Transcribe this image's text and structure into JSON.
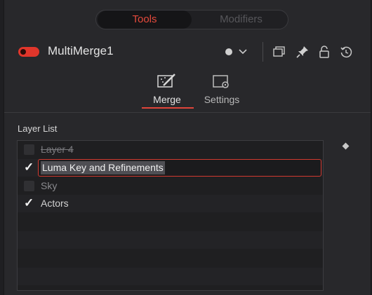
{
  "top_tabs": {
    "tools": "Tools",
    "modifiers": "Modifiers"
  },
  "header": {
    "node_name": "MultiMerge1"
  },
  "icons": {
    "node_toggle": "enable-toggle-icon",
    "version": "dot-icon",
    "dropdown": "chevron-down-icon",
    "window": "window-icon",
    "pin": "pin-icon",
    "lock": "lock-icon",
    "reset": "reset-icon"
  },
  "sub_tabs": {
    "merge": "Merge",
    "settings": "Settings"
  },
  "layer_list": {
    "title": "Layer List",
    "layers": [
      {
        "name": "Layer 4",
        "checked": false,
        "style": "strike"
      },
      {
        "name": "Luma Key and Refinements",
        "checked": true,
        "style": "editing"
      },
      {
        "name": "Sky",
        "checked": false,
        "style": "dim"
      },
      {
        "name": "Actors",
        "checked": true,
        "style": "normal"
      }
    ]
  },
  "colors": {
    "accent": "#e0453a",
    "background": "#28282b"
  }
}
